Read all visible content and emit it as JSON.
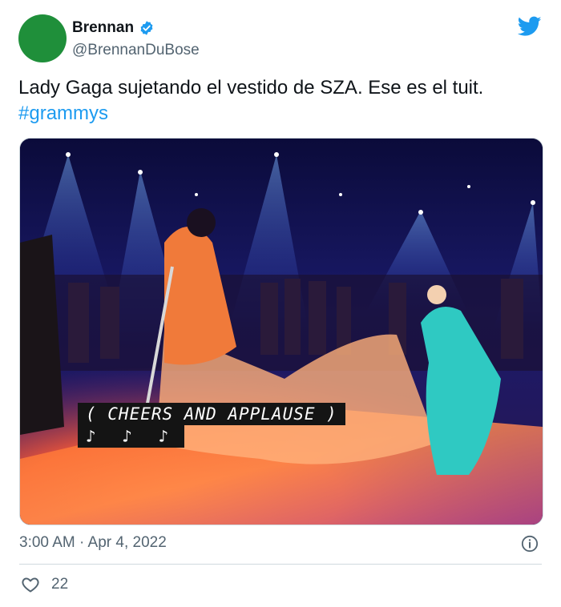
{
  "tweet": {
    "author_name": "Brennan",
    "author_handle": "@BrennanDuBose",
    "text": "Lady Gaga sujetando el vestido de SZA. Ese es el tuit.",
    "hashtag": "#grammys",
    "timestamp": "3:00 AM · Apr 4, 2022",
    "like_count": "22"
  },
  "media": {
    "caption_line1": "( CHEERS AND APPLAUSE )",
    "caption_line2": "♪ ♪ ♪"
  },
  "icons": {
    "verified": "verified-badge-icon",
    "brand": "twitter-bird-icon",
    "info": "info-icon",
    "like": "heart-icon"
  },
  "colors": {
    "accent": "#1d9bf0",
    "avatar": "#1f8f3a",
    "secondary_text": "#536471"
  }
}
